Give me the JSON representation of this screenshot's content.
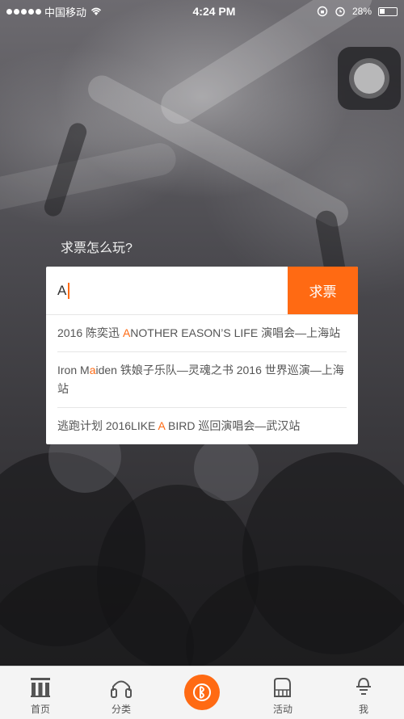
{
  "status_bar": {
    "carrier": "中国移动",
    "time": "4:24 PM",
    "battery": "28%"
  },
  "howto_link": "求票怎么玩?",
  "search": {
    "value": "A",
    "button_label": "求票"
  },
  "suggestions": [
    {
      "before": "2016 陈奕迅 ",
      "highlight": "A",
      "after": "NOTHER EASON’S LIFE 演唱会—上海站"
    },
    {
      "before": "Iron M",
      "highlight": "a",
      "after": "iden 铁娘子乐队—灵魂之书 2016 世界巡演—上海站"
    },
    {
      "before": "逃跑计划 2016LIKE ",
      "highlight": "A",
      "after": " BIRD 巡回演唱会—武汉站"
    }
  ],
  "tabs": [
    {
      "label": "首页",
      "icon": "home-icon"
    },
    {
      "label": "分类",
      "icon": "headphones-icon"
    },
    {
      "label": "",
      "icon": "center-ticket-icon"
    },
    {
      "label": "活动",
      "icon": "piano-icon"
    },
    {
      "label": "我",
      "icon": "person-icon"
    }
  ],
  "colors": {
    "accent": "#ff6a13"
  }
}
